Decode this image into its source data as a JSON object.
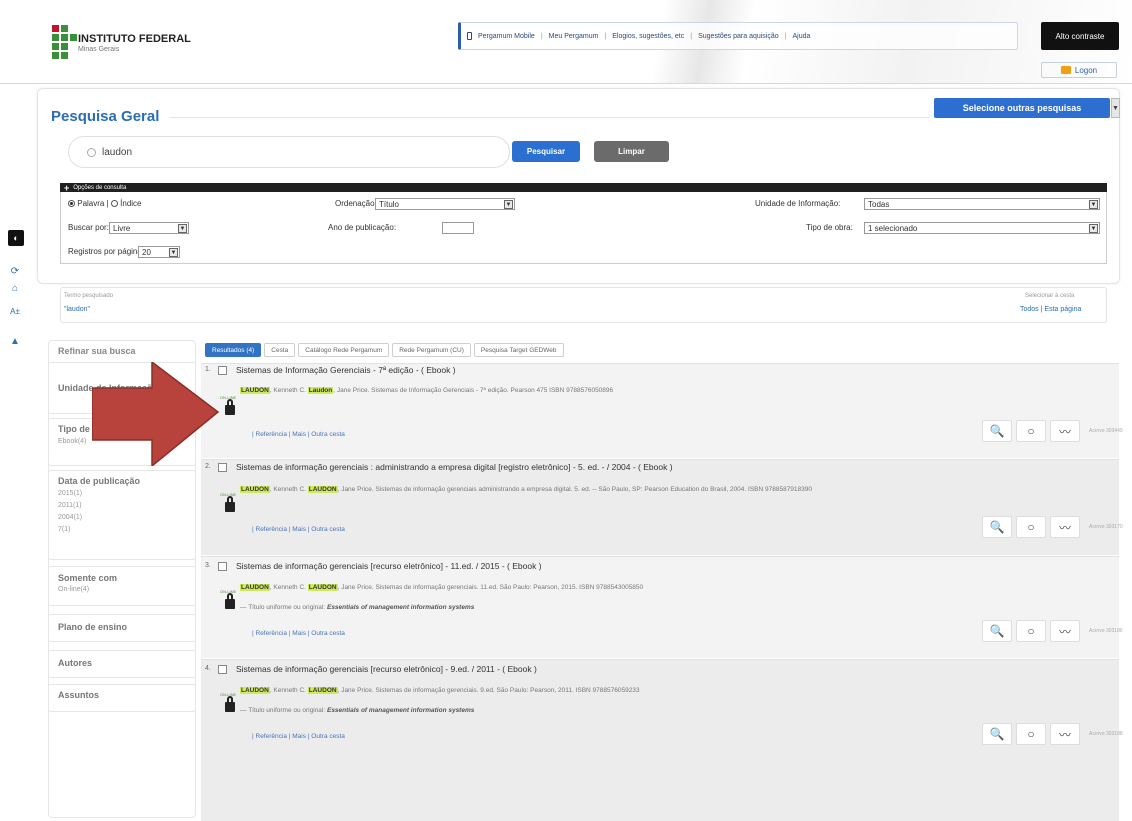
{
  "header": {
    "logo_title": "INSTITUTO FEDERAL",
    "logo_subtitle": "Minas Gerais",
    "nav": [
      "Pergamum Mobile",
      "Meu Pergamum",
      "Elogios, sugestões, etc",
      "Sugestões para aquisição",
      "Ajuda"
    ],
    "high_contrast": "Alto contraste",
    "login": "Logon"
  },
  "search": {
    "title": "Pesquisa Geral",
    "other_searches": "Selecione outras pesquisas",
    "query": "laudon",
    "search_button": "Pesquisar",
    "clear_button": "Limpar",
    "options_label": "Opções de consulta",
    "radio_word": "Palavra",
    "radio_index": "Índice",
    "search_by_label": "Buscar por:",
    "search_by_value": "Livre",
    "records_label": "Registros por página:",
    "records_value": "20",
    "order_label": "Ordenação:",
    "order_value": "Título",
    "year_label": "Ano de publicação:",
    "unit_label": "Unidade de Informação:",
    "unit_value": "Todas",
    "type_label": "Tipo de obra:",
    "type_value": "1 selecionado"
  },
  "term": {
    "label": "Termo pesquisado",
    "value": "\"laudon\"",
    "select_label": "Selecionar à cesta",
    "all": "Todos",
    "this_page": "Esta página"
  },
  "refine": {
    "title": "Refinar sua busca",
    "unit_title": "Unidade de Informação",
    "type_title": "Tipo de obra",
    "type_item": "Ebook(4)",
    "date_title": "Data de publicação",
    "date_items": [
      "2015(1)",
      "2011(1)",
      "2004(1)",
      "7(1)"
    ],
    "only_title": "Somente com",
    "only_item": "On-line(4)",
    "plans_title": "Plano de ensino",
    "authors_title": "Autores",
    "subjects_title": "Assuntos"
  },
  "tabs": [
    "Resultados (4)",
    "Cesta",
    "Catálogo Rede Pergamum",
    "Rede Pergamum (CU)",
    "Pesquisa Target GEDWeb"
  ],
  "records": [
    {
      "num": "1.",
      "title": "Sistemas de Informação Gerenciais - 7ª edição - ( Ebook )",
      "author_a": "LAUDON",
      "author_a_rest": ", Kenneth C.",
      "author_b": "Laudon",
      "author_b_rest": ", Jane Price. Sistemas de Informação Gerenciais - 7ª edição. Pearson 475 ISBN 9788576050896",
      "uniform_label": "",
      "uniform_value": "",
      "acc": "Acervo 303449"
    },
    {
      "num": "2.",
      "title": "Sistemas de informação gerenciais : administrando a empresa digital [registro eletrônico] - 5. ed. - / 2004 - ( Ebook )",
      "author_a": "LAUDON",
      "author_a_rest": ", Kenneth C.",
      "author_b": "LAUDON",
      "author_b_rest": ", Jane Price. Sistemas de informação gerenciais administrando a empresa digital. 5. ed. -- São Paulo, SP: Pearson Education do Brasil, 2004. ISBN 9788587918390",
      "uniform_label": "",
      "uniform_value": "",
      "acc": "Acervo 303170"
    },
    {
      "num": "3.",
      "title": "Sistemas de informação gerenciais [recurso eletrônico] - 11.ed. / 2015 - ( Ebook )",
      "author_a": "LAUDON",
      "author_a_rest": ", Kenneth C.",
      "author_b": "LAUDON",
      "author_b_rest": ", Jane Price. Sistemas de informação gerenciais. 11.ed. São Paulo: Pearson, 2015. ISBN 9788543005850",
      "uniform_label": "Título uniforme ou original:",
      "uniform_value": "Essentials of management information systems",
      "acc": "Acervo 303186"
    },
    {
      "num": "4.",
      "title": "Sistemas de informação gerenciais [recurso eletrônico] - 9.ed. / 2011 - ( Ebook )",
      "author_a": "LAUDON",
      "author_a_rest": ", Kenneth C.",
      "author_b": "LAUDON",
      "author_b_rest": ", Jane Price. Sistemas de informação gerenciais. 9.ed. São Paulo: Pearson, 2011. ISBN 9788576059233",
      "uniform_label": "Título uniforme ou original:",
      "uniform_value": "Essentials of management information systems",
      "acc": "Acervo 303188"
    }
  ],
  "record_links": {
    "reference": "Referência",
    "more": "Mais",
    "cite": "Outra cesta"
  },
  "ebook_label": "ON-LINE",
  "colors": {
    "accent": "#2c6db3",
    "highlight": "#cde95c",
    "arrow": "#b8423c"
  }
}
